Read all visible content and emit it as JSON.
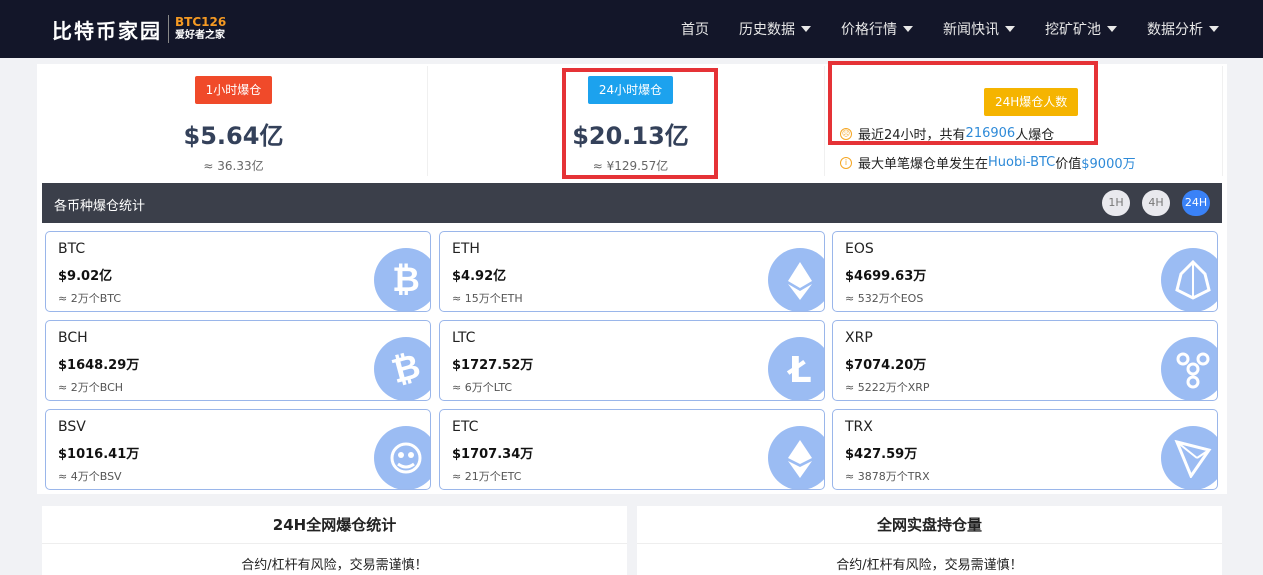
{
  "header": {
    "logo_cn": "比特币家园",
    "logo_en": "BTC126",
    "logo_sub": "爱好者之家",
    "nav": [
      {
        "label": "首页",
        "dropdown": false
      },
      {
        "label": "历史数据",
        "dropdown": true
      },
      {
        "label": "价格行情",
        "dropdown": true
      },
      {
        "label": "新闻快讯",
        "dropdown": true
      },
      {
        "label": "挖矿矿池",
        "dropdown": true
      },
      {
        "label": "数据分析",
        "dropdown": true
      }
    ]
  },
  "stats": {
    "hour1": {
      "tag": "1小时爆仓",
      "value": "$5.64亿",
      "sub": "≈ 36.33亿"
    },
    "hour24": {
      "tag": "24小时爆仓",
      "value": "$20.13亿",
      "sub": "≈ ¥129.57亿"
    },
    "people": {
      "tag": "24H爆仓人数",
      "line1_pre": "最近24小时，共有",
      "line1_num": "216906",
      "line1_post": "人爆仓",
      "line2_pre": "最大单笔爆仓单发生在",
      "line2_exchange": "Huobi-BTC",
      "line2_mid": "价值",
      "line2_value": "$9000万"
    }
  },
  "section": {
    "title": "各币种爆仓统计",
    "ranges": [
      "1H",
      "4H",
      "24H"
    ],
    "active_range": "24H"
  },
  "coins": [
    {
      "sym": "BTC",
      "value": "$9.02亿",
      "sub": "≈ 2万个BTC",
      "icon": "bitcoin-icon"
    },
    {
      "sym": "ETH",
      "value": "$4.92亿",
      "sub": "≈ 15万个ETH",
      "icon": "ethereum-icon"
    },
    {
      "sym": "EOS",
      "value": "$4699.63万",
      "sub": "≈ 532万个EOS",
      "icon": "eos-icon"
    },
    {
      "sym": "BCH",
      "value": "$1648.29万",
      "sub": "≈ 2万个BCH",
      "icon": "bitcoin-cash-icon"
    },
    {
      "sym": "LTC",
      "value": "$1727.52万",
      "sub": "≈ 6万个LTC",
      "icon": "litecoin-icon"
    },
    {
      "sym": "XRP",
      "value": "$7074.20万",
      "sub": "≈ 5222万个XRP",
      "icon": "ripple-icon"
    },
    {
      "sym": "BSV",
      "value": "$1016.41万",
      "sub": "≈ 4万个BSV",
      "icon": "bsv-icon"
    },
    {
      "sym": "ETC",
      "value": "$1707.34万",
      "sub": "≈ 21万个ETC",
      "icon": "ethereum-classic-icon"
    },
    {
      "sym": "TRX",
      "value": "$427.59万",
      "sub": "≈ 3878万个TRX",
      "icon": "tron-icon"
    }
  ],
  "panels": [
    {
      "title": "24H全网爆仓统计",
      "note": "合约/杠杆有风险，交易需谨慎！"
    },
    {
      "title": "全网实盘持仓量",
      "note": "合约/杠杆有风险，交易需谨慎！"
    }
  ],
  "colors": {
    "header_bg": "#131629",
    "accent_red": "#f04a2a",
    "accent_blue": "#1ca2ee",
    "accent_amber": "#f5b400",
    "highlight_box": "#e53236",
    "link": "#2e8ad8"
  }
}
